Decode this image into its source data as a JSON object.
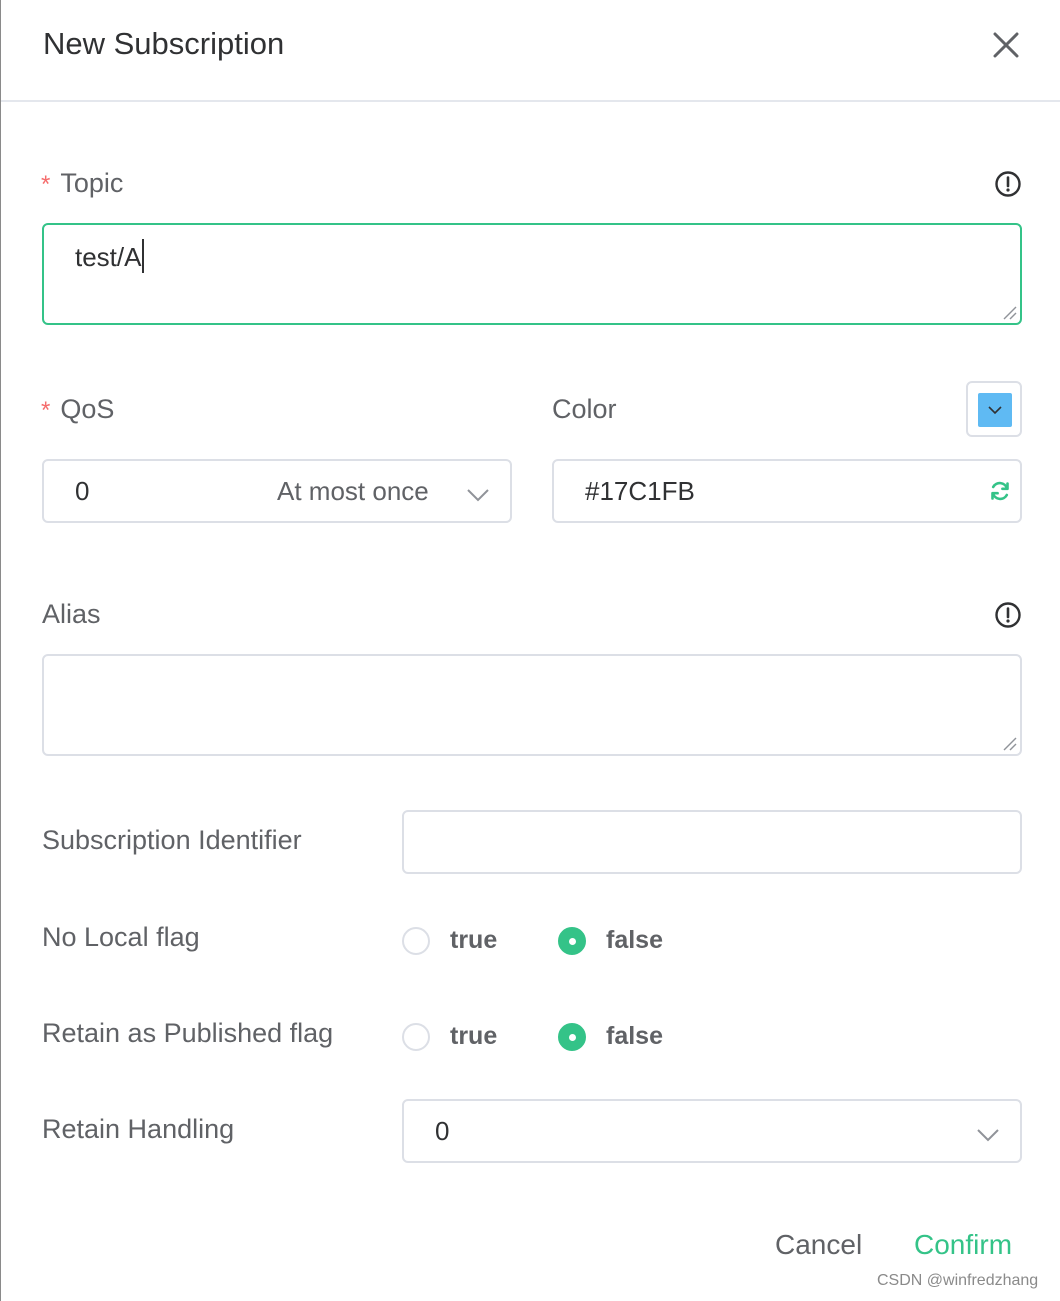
{
  "dialog": {
    "title": "New Subscription",
    "cancel_label": "Cancel",
    "confirm_label": "Confirm"
  },
  "topic": {
    "required_mark": "*",
    "label": "Topic",
    "value": "test/A"
  },
  "qos": {
    "required_mark": "*",
    "label": "QoS",
    "value": "0",
    "description": "At most once"
  },
  "color": {
    "label": "Color",
    "value": "#17C1FB",
    "swatch": "#5fbaf3"
  },
  "alias": {
    "label": "Alias",
    "value": ""
  },
  "subscription_identifier": {
    "label": "Subscription Identifier",
    "value": ""
  },
  "no_local": {
    "label": "No Local flag",
    "options": [
      "true",
      "false"
    ],
    "selected": "false"
  },
  "retain_as_published": {
    "label": "Retain as Published flag",
    "options": [
      "true",
      "false"
    ],
    "selected": "false"
  },
  "retain_handling": {
    "label": "Retain Handling",
    "value": "0"
  },
  "watermark": "CSDN @winfredzhang",
  "colors": {
    "accent": "#34c388",
    "required": "#f56c6c",
    "border": "#dcdfe6",
    "text": "#606266"
  },
  "icons": {
    "close": "close-icon",
    "info": "info-icon",
    "chevron": "chevron-down-icon",
    "refresh": "refresh-icon"
  }
}
